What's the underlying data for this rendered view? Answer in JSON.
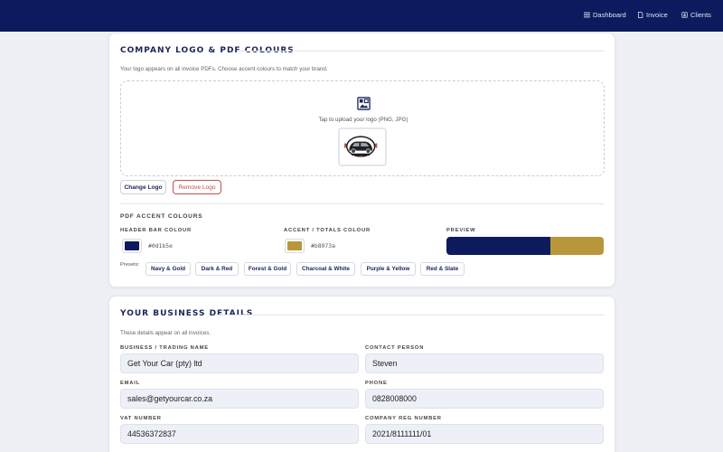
{
  "nav": {
    "items": [
      {
        "label": "Dashboard",
        "icon": "list-icon"
      },
      {
        "label": "Invoice",
        "icon": "document-icon"
      },
      {
        "label": "Clients",
        "icon": "people-icon"
      }
    ]
  },
  "branding": {
    "title": "COMPANY LOGO & PDF COLOURS",
    "description": "Your logo appears on all invoice PDFs. Choose accent colours to match your brand.",
    "upload_text": "Tap to upload your logo (PNG, JPG)",
    "change_logo_label": "Change Logo",
    "remove_logo_label": "Remove Logo",
    "accent_heading": "PDF ACCENT COLOURS",
    "header_bar_label": "HEADER BAR COLOUR",
    "header_bar_hex": "#0d1b5e",
    "accent_label": "ACCENT / TOTALS COLOUR",
    "accent_hex": "#b8973a",
    "preview_label": "PREVIEW",
    "presets_label": "Presets:",
    "presets": [
      "Navy & Gold",
      "Dark & Red",
      "Forest & Gold",
      "Charcoal & White",
      "Purple & Yellow",
      "Red & Slate"
    ]
  },
  "business": {
    "title": "YOUR BUSINESS DETAILS",
    "description": "These details appear on all invoices.",
    "fields": {
      "trading_name": {
        "label": "BUSINESS / TRADING NAME",
        "value": "Get Your Car (pty) ltd"
      },
      "contact_person": {
        "label": "CONTACT PERSON",
        "value": "Steven"
      },
      "email": {
        "label": "EMAIL",
        "value": "sales@getyourcar.co.za"
      },
      "phone": {
        "label": "PHONE",
        "value": "0828008000"
      },
      "vat": {
        "label": "VAT NUMBER",
        "value": "44536372837"
      },
      "reg": {
        "label": "COMPANY REG NUMBER",
        "value": "2021/8111111/01"
      }
    }
  },
  "colors": {
    "navy": "#0d1b5e",
    "gold": "#b8973a"
  }
}
